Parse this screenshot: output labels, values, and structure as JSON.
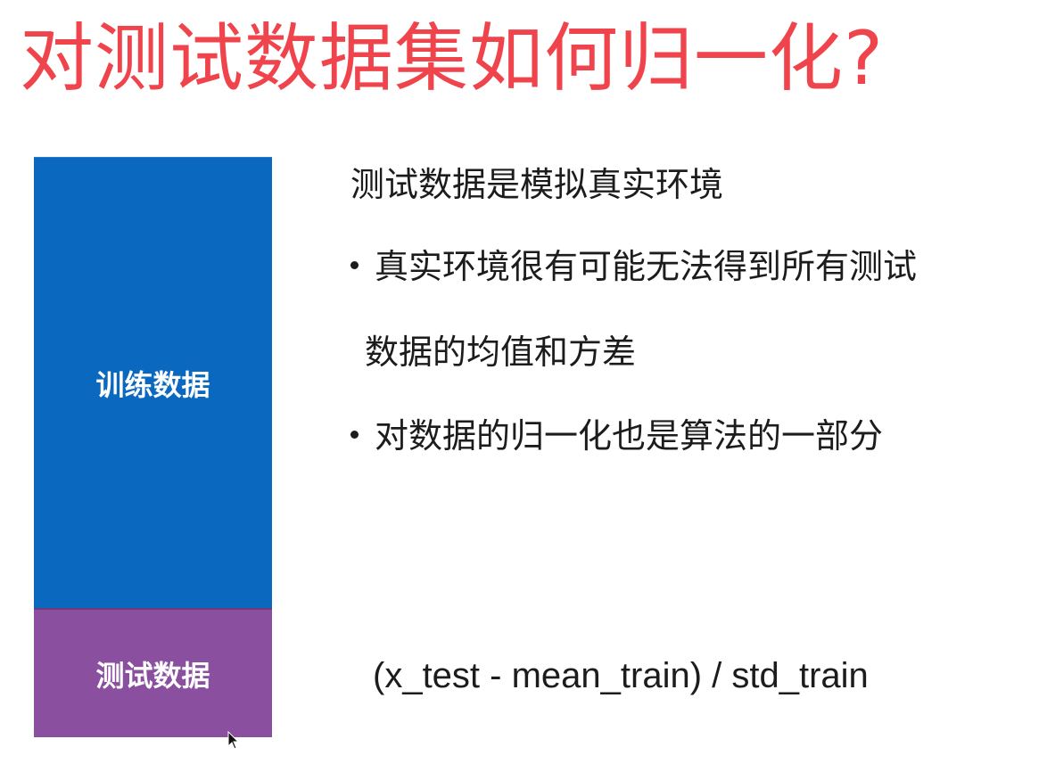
{
  "title": "对测试数据集如何归一化?",
  "blocks": {
    "train_label": "训练数据",
    "test_label": "测试数据",
    "train_color": "#0a68bf",
    "test_color": "#8a4f9f"
  },
  "content": {
    "intro": "测试数据是模拟真实环境",
    "bullets": [
      {
        "line1": "真实环境很有可能无法得到所有测试",
        "line2": "数据的均值和方差"
      },
      {
        "line1": "对数据的归一化也是算法的一部分"
      }
    ],
    "formula": "(x_test - mean_train) / std_train"
  },
  "colors": {
    "title": "#f0444d",
    "text": "#1c1c1c",
    "background": "#ffffff"
  },
  "icons": {
    "cursor": "mouse-pointer-icon"
  }
}
